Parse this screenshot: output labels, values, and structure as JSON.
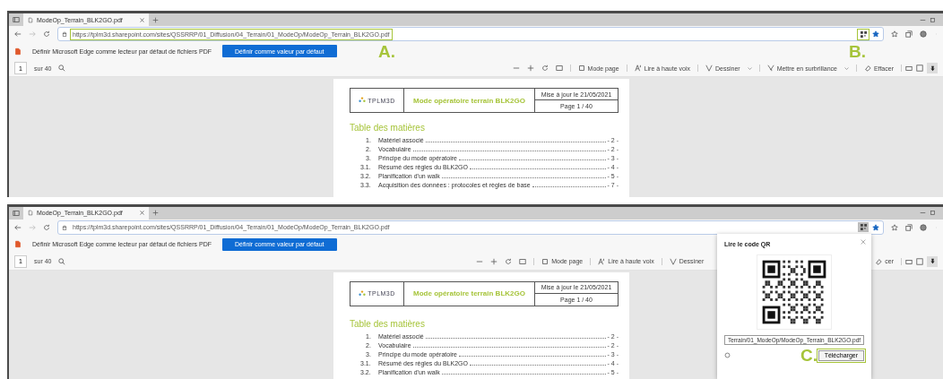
{
  "panels": [
    {
      "tab": {
        "title": "ModeOp_Terrain_BLK2GO.pdf"
      },
      "url": "https://tplm3d.sharepoint.com/sites/QSSRRP/01_Diffusion/04_Terrain/01_ModeOp/ModeOp_Terrain_BLK2GO.pdf",
      "qr_button": {
        "selected": false
      },
      "infobar": {
        "message": "Définir Microsoft Edge comme lecteur par défaut de fichiers PDF",
        "button": "Définir comme valeur par défaut"
      },
      "pdf_toolbar": {
        "page": "1",
        "page_count": "sur 40",
        "tools": [
          {
            "kind": "mode",
            "label": "Mode page"
          },
          {
            "kind": "read",
            "label": "Lire à haute voix"
          },
          {
            "kind": "draw",
            "label": "Dessiner"
          },
          {
            "kind": "highlight",
            "label": "Mettre en surbrillance"
          },
          {
            "kind": "erase",
            "label": "Effacer"
          }
        ]
      },
      "document": {
        "logo": "TPLM3D",
        "title": "Mode opératoire terrain BLK2GO",
        "updated": "Mise à jour le 21/05/2021",
        "page": "Page 1 / 40",
        "toc_heading": "Table des matières",
        "toc": [
          {
            "number": "1.",
            "title": "Matériel associé",
            "page": "- 2 -"
          },
          {
            "number": "2.",
            "title": "Vocabulaire",
            "page": "- 2 -"
          },
          {
            "number": "3.",
            "title": "Principe du mode opératoire",
            "page": "- 3 -"
          },
          {
            "number": "3.1.",
            "title": "Résumé des règles du BLK2GO",
            "page": "- 4 -"
          },
          {
            "number": "3.2.",
            "title": "Planification d'un walk",
            "page": "- 5 -"
          },
          {
            "number": "3.3.",
            "title": "Acquisition des données : protocoles et règles de base",
            "page": "- 7 -"
          }
        ]
      },
      "annotations": [
        {
          "label": "A.",
          "kind": "url"
        },
        {
          "label": "B.",
          "kind": "qr"
        }
      ]
    },
    {
      "tab": {
        "title": "ModeOp_Terrain_BLK2GO.pdf"
      },
      "url": "https://tplm3d.sharepoint.com/sites/QSSRRP/01_Diffusion/04_Terrain/01_ModeOp/ModeOp_Terrain_BLK2GO.pdf",
      "qr_button": {
        "selected": true
      },
      "infobar": {
        "message": "Définir Microsoft Edge comme lecteur par défaut de fichiers PDF",
        "button": "Définir comme valeur par défaut"
      },
      "pdf_toolbar": {
        "page": "1",
        "page_count": "sur 40",
        "tools": [
          {
            "kind": "mode",
            "label": "Mode page"
          },
          {
            "kind": "read",
            "label": "Lire à haute voix"
          },
          {
            "kind": "draw",
            "label": "Dessiner"
          },
          {
            "kind": "erase",
            "label": "cer"
          }
        ]
      },
      "document": {
        "logo": "TPLM3D",
        "title": "Mode opératoire terrain BLK2GO",
        "updated": "Mise à jour le 21/05/2021",
        "page": "Page 1 / 40",
        "toc_heading": "Table des matières",
        "toc": [
          {
            "number": "1.",
            "title": "Matériel associé",
            "page": "- 2 -"
          },
          {
            "number": "2.",
            "title": "Vocabulaire",
            "page": "- 2 -"
          },
          {
            "number": "3.",
            "title": "Principe du mode opératoire",
            "page": "- 3 -"
          },
          {
            "number": "3.1.",
            "title": "Résumé des règles du BLK2GO",
            "page": "- 4 -"
          },
          {
            "number": "3.2.",
            "title": "Planification d'un walk",
            "page": "- 5 -"
          }
        ]
      },
      "qr_popup": {
        "title": "Lire le code QR",
        "field_value": "Terrain/01_ModeOp/ModeOp_Terrain_BLK2GO.pdf",
        "button": "Télécharger"
      },
      "annotations": [
        {
          "label": "C.",
          "kind": "download"
        }
      ]
    }
  ]
}
